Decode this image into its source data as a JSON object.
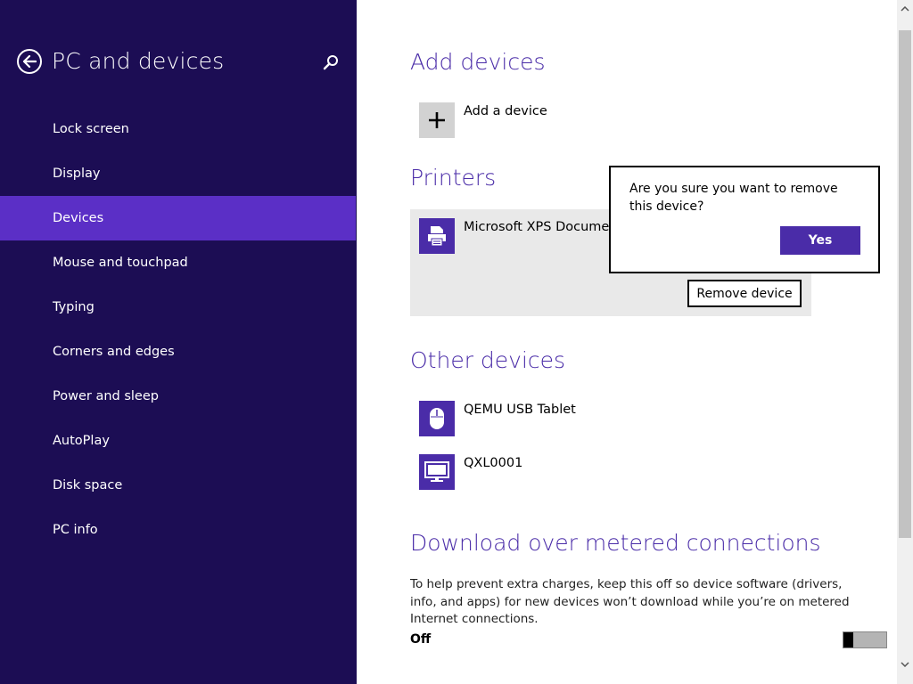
{
  "sidebar": {
    "title": "PC and devices",
    "items": [
      {
        "label": "Lock screen"
      },
      {
        "label": "Display"
      },
      {
        "label": "Devices",
        "active": true
      },
      {
        "label": "Mouse and touchpad"
      },
      {
        "label": "Typing"
      },
      {
        "label": "Corners and edges"
      },
      {
        "label": "Power and sleep"
      },
      {
        "label": "AutoPlay"
      },
      {
        "label": "Disk space"
      },
      {
        "label": "PC info"
      }
    ]
  },
  "main": {
    "add_devices": {
      "title": "Add devices",
      "add_label": "Add a device"
    },
    "printers": {
      "title": "Printers",
      "device_name": "Microsoft XPS Document",
      "remove_label": "Remove device"
    },
    "other_devices": {
      "title": "Other devices",
      "items": [
        {
          "label": "QEMU USB Tablet",
          "icon": "mouse-icon"
        },
        {
          "label": "QXL0001",
          "icon": "monitor-icon"
        }
      ]
    },
    "metered": {
      "title": "Download over metered connections",
      "description": "To help prevent extra charges, keep this off so device software (drivers, info, and apps) for new devices won’t download while you’re on metered Internet connections.",
      "toggle_label": "Off"
    }
  },
  "dialog": {
    "message": "Are you sure you want to remove this device?",
    "yes_label": "Yes"
  },
  "colors": {
    "sidebar_bg": "#1c0d54",
    "accent": "#5b2fc6",
    "heading": "#4a2ca8",
    "panel": "#e9e9e9"
  }
}
